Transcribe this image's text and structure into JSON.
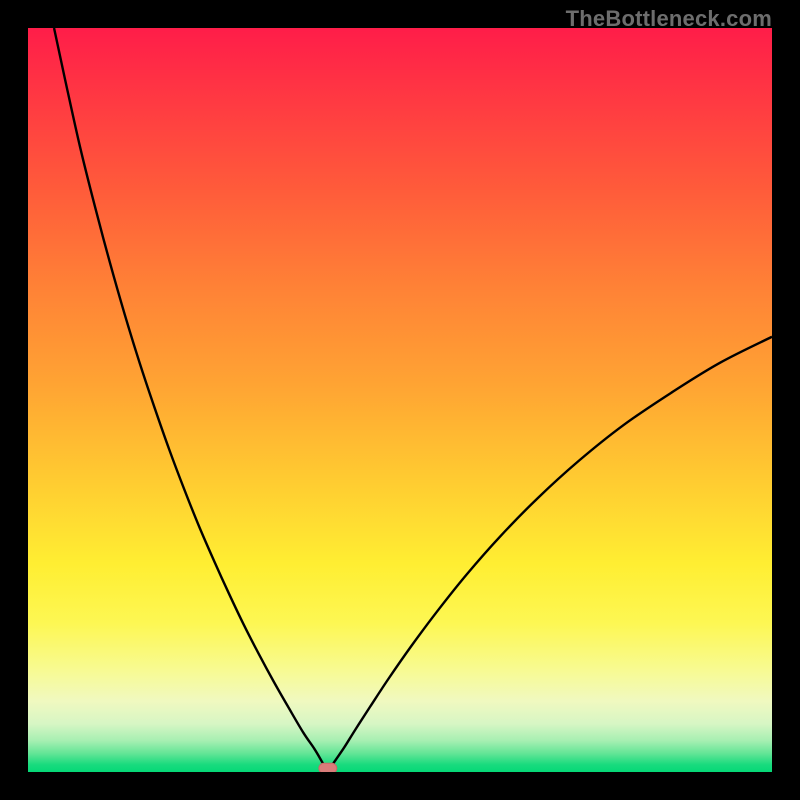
{
  "watermark": "TheBottleneck.com",
  "colors": {
    "frame": "#000000",
    "curve": "#000000",
    "marker_fill": "#d97d7a",
    "marker_stroke": "#c86a68",
    "gradient_stops": [
      {
        "offset": 0.0,
        "color": "#ff1d49"
      },
      {
        "offset": 0.1,
        "color": "#ff3a42"
      },
      {
        "offset": 0.22,
        "color": "#ff5c3a"
      },
      {
        "offset": 0.35,
        "color": "#ff8236"
      },
      {
        "offset": 0.48,
        "color": "#ffa433"
      },
      {
        "offset": 0.6,
        "color": "#ffc931"
      },
      {
        "offset": 0.72,
        "color": "#ffee32"
      },
      {
        "offset": 0.8,
        "color": "#fdf753"
      },
      {
        "offset": 0.86,
        "color": "#f8fa8f"
      },
      {
        "offset": 0.905,
        "color": "#f0f9c0"
      },
      {
        "offset": 0.935,
        "color": "#d7f6c4"
      },
      {
        "offset": 0.958,
        "color": "#a6efb2"
      },
      {
        "offset": 0.975,
        "color": "#63e596"
      },
      {
        "offset": 0.99,
        "color": "#19db7e"
      },
      {
        "offset": 1.0,
        "color": "#05d877"
      }
    ]
  },
  "chart_data": {
    "type": "line",
    "title": "",
    "xlabel": "",
    "ylabel": "",
    "xlim": [
      0,
      100
    ],
    "ylim": [
      0,
      100
    ],
    "optimum_x": 40.3,
    "marker": {
      "x": 40.3,
      "y": 0.5
    },
    "series": [
      {
        "name": "left-branch",
        "x": [
          3.5,
          5,
          7,
          9,
          11,
          13,
          15,
          17,
          19,
          21,
          23,
          25,
          27,
          29,
          31,
          33,
          35,
          37,
          38.5,
          39.5,
          40.3
        ],
        "values": [
          100,
          93,
          84,
          76,
          68.5,
          61.5,
          55,
          49,
          43.3,
          38,
          33,
          28.4,
          24,
          19.8,
          15.9,
          12.2,
          8.7,
          5.3,
          3.1,
          1.4,
          0
        ]
      },
      {
        "name": "right-branch",
        "x": [
          40.3,
          41.2,
          42.5,
          44,
          46,
          48.5,
          51.5,
          55,
          59,
          63.5,
          68.5,
          74,
          80,
          86.5,
          93,
          100
        ],
        "values": [
          0,
          1.4,
          3.3,
          5.7,
          8.8,
          12.6,
          16.9,
          21.6,
          26.6,
          31.7,
          36.8,
          41.8,
          46.6,
          51,
          55,
          58.5
        ]
      }
    ]
  }
}
